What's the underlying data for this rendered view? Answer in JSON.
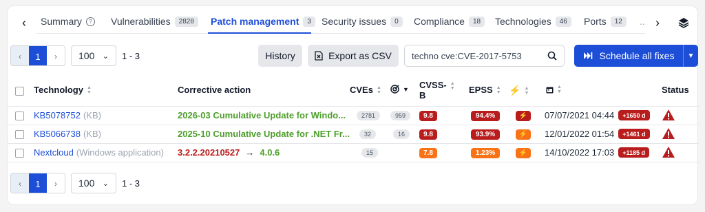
{
  "tabs": [
    {
      "label": "Summary",
      "count": ""
    },
    {
      "label": "Vulnerabilities",
      "count": "2828"
    },
    {
      "label": "Patch management",
      "count": "3"
    },
    {
      "label": "Security issues",
      "count": "0"
    },
    {
      "label": "Compliance",
      "count": "18"
    },
    {
      "label": "Technologies",
      "count": "46"
    },
    {
      "label": "Ports",
      "count": "12"
    },
    {
      "label": "..",
      "count": ""
    }
  ],
  "pagination": {
    "current_page": "1",
    "page_size": "100",
    "range": "1 - 3"
  },
  "toolbar": {
    "history": "History",
    "export": "Export as CSV",
    "search_value": "techno cve:CVE-2017-5753",
    "schedule": "Schedule all fixes"
  },
  "table": {
    "headers": {
      "technology": "Technology",
      "corrective_action": "Corrective action",
      "cves": "CVEs",
      "cvss": "CVSS-\nB",
      "epss": "EPSS",
      "status": "Status"
    },
    "rows": [
      {
        "name": "KB5078752",
        "type": "(KB)",
        "action_fix": "2026-03 Cumulative Update for Windo...",
        "action_from": "",
        "action_to": "",
        "cves": "2781",
        "exploits": "959",
        "cvss": "9.8",
        "cvss_color": "#b91c1c",
        "epss": "94.4%",
        "epss_color": "#b91c1c",
        "exploit_color": "#b91c1c",
        "date": "07/07/2021 04:44",
        "age": "+1650 d"
      },
      {
        "name": "KB5066738",
        "type": "(KB)",
        "action_fix": "2025-10 Cumulative Update for .NET Fr...",
        "action_from": "",
        "action_to": "",
        "cves": "32",
        "exploits": "16",
        "cvss": "9.8",
        "cvss_color": "#b91c1c",
        "epss": "93.9%",
        "epss_color": "#b91c1c",
        "exploit_color": "#f97316",
        "date": "12/01/2022 01:54",
        "age": "+1461 d"
      },
      {
        "name": "Nextcloud",
        "type": "(Windows application)",
        "action_fix": "",
        "action_from": "3.2.2.20210527",
        "action_to": "4.0.6",
        "cves": "15",
        "exploits": "",
        "cvss": "7.8",
        "cvss_color": "#f97316",
        "epss": "1.23%",
        "epss_color": "#f97316",
        "exploit_color": "#f97316",
        "date": "14/10/2022 17:03",
        "age": "+1185 d"
      }
    ]
  },
  "footer_pagination": {
    "current_page": "1",
    "page_size": "100",
    "range": "1 - 3"
  }
}
